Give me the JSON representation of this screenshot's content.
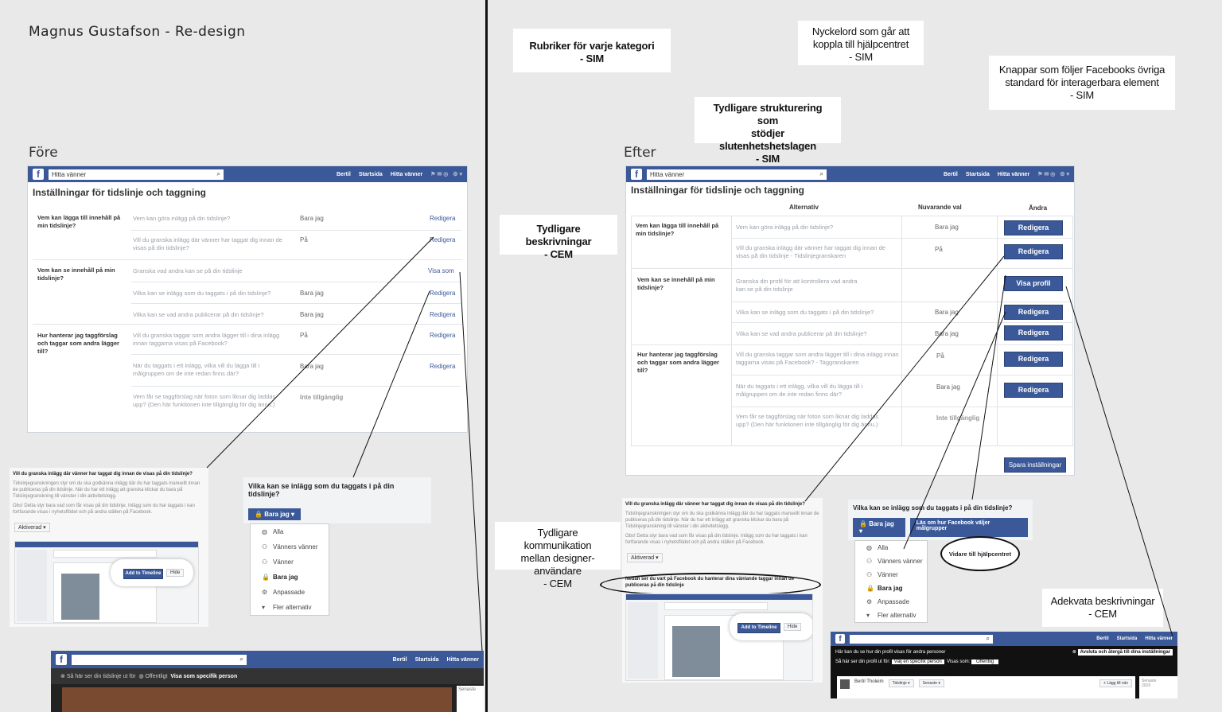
{
  "doc": {
    "title": "Magnus Gustafson - Re-design",
    "before_label": "Före",
    "after_label": "Efter"
  },
  "notes": {
    "rubriker": "Rubriker för varje kategori\n- SIM",
    "nyckelord": "Nyckelord som går att\nkoppla till hjälpcentret\n- SIM",
    "knappar": "Knappar som följer Facebooks övriga\nstandard för interagerbara element\n- SIM",
    "struktur": "Tydligare strukturering som\nstödjer slutenhetshetslagen\n- SIM",
    "beskrivningar": "Tydligare beskrivningar\n- CEM",
    "kommunikation": "Tydligare kommunikation\nmellan designer-användare\n- CEM",
    "adekvata": "Adekvata beskrivningar\n- CEM"
  },
  "fb": {
    "search_placeholder": "Hitta vänner",
    "user": "Bertil",
    "home": "Startsida",
    "find_friends": "Hitta vänner"
  },
  "before": {
    "panel_title": "Inställningar för tidslinje och taggning",
    "sections": [
      {
        "heading": "Vem kan lägga till innehåll på min tidslinje?",
        "rows": [
          {
            "desc": "Vem kan göra inlägg på din tidslinje?",
            "value": "Bara jag",
            "action": "Redigera"
          },
          {
            "desc": "Vill du granska inlägg där vänner har taggat dig innan de visas på din tidslinje?",
            "value": "På",
            "action": "Redigera"
          }
        ]
      },
      {
        "heading": "Vem kan se innehåll på min tidslinje?",
        "rows": [
          {
            "desc": "Granska vad andra kan se på din tidslinje",
            "value": "",
            "action": "Visa som"
          },
          {
            "desc": "Vilka kan se inlägg som du taggats i på din tidslinje?",
            "value": "Bara jag",
            "action": "Redigera"
          },
          {
            "desc": "Vilka kan se vad andra publicerar på din tidslinje?",
            "value": "Bara jag",
            "action": "Redigera"
          }
        ]
      },
      {
        "heading": "Hur hanterar jag taggförslag och taggar som andra lägger till?",
        "rows": [
          {
            "desc": "Vill du granska taggar som andra lägger till i dina inlägg innan taggarna visas på Facebook?",
            "value": "På",
            "action": "Redigera"
          },
          {
            "desc": "När du taggats i ett inlägg, vilka vill du lägga till i målgruppen om de inte redan finns där?",
            "value": "Bara jag",
            "action": "Redigera"
          },
          {
            "desc": "Vem får se taggförslag när foton som liknar dig laddas upp? (Den här funktionen inte tillgänglig för dig ännu.)",
            "value": "Inte tillgänglig",
            "action": ""
          }
        ]
      }
    ],
    "popup_review": {
      "title": "Vill du granska inlägg där vänner har taggat dig innan de visas på din tidslinje?",
      "body": "Tidslinjegranskningen styr om du ska godkänna inlägg där du har taggats manuellt innan de publiceras på din tidslinje. När du har ett inlägg att granska klickar du bara på Tidslinjegranskning till vänster i din aktivitetslogg.",
      "body2": "Obs! Detta styr bara vad som får visas på din tidslinje. Inlägg som du har taggats i kan fortfarande visas i nyhetsflödet och på andra ställen på Facebook.",
      "control": "Aktiverad",
      "add_btn": "Add to Timeline",
      "hide_btn": "Hide"
    },
    "popup_audience": {
      "title": "Vilka kan se inlägg som du taggats i på din tidslinje?",
      "selected": "Bara jag",
      "options": [
        "Alla",
        "Vänners vänner",
        "Vänner",
        "Bara jag",
        "Anpassade",
        "Fler alternativ"
      ]
    },
    "viewas_bar": {
      "text": "Så här ser din tidslinje ut för",
      "public": "Offentligt",
      "specific": "Visa som specifik person",
      "side": "Senaste"
    }
  },
  "after": {
    "panel_title": "Inställningar för tidslinje och taggning",
    "col_alt": "Alternativ",
    "col_cur": "Nuvarande val",
    "col_change": "Ändra",
    "sections": [
      {
        "heading": "Vem kan lägga till innehåll på min tidslinje?",
        "rows": [
          {
            "desc": "Vem kan göra inlägg på din tidslinje?",
            "value": "Bara jag",
            "action": "Redigera"
          },
          {
            "desc": "Vill du granska inlägg där vänner har taggat dig innan de visas på din tidslinje - Tidslinjegranskaren",
            "value": "På",
            "action": "Redigera"
          }
        ]
      },
      {
        "heading": "Vem kan se innehåll på min tidslinje?",
        "rows": [
          {
            "desc": "Granska din profil för att kontrollera vad andra kan se på din tidslinje",
            "value": "",
            "action": "Visa profil"
          },
          {
            "desc": "Vilka kan se inlägg som du taggats i på din tidslinje?",
            "value": "Bara jag",
            "action": "Redigera"
          },
          {
            "desc": "Vilka kan se vad andra publicerar på din tidslinje?",
            "value": "Bara jag",
            "action": "Redigera"
          }
        ]
      },
      {
        "heading": "Hur hanterar jag taggförslag och taggar som andra lägger till?",
        "rows": [
          {
            "desc": "Vill du granska taggar som andra lägger till i dina inlägg innan taggarna visas på Facebook? - Taggranskaren",
            "value": "På",
            "action": "Redigera"
          },
          {
            "desc": "När du taggats i ett inlägg, vilka vill du lägga till i målgruppen om de inte redan finns där?",
            "value": "Bara jag",
            "action": "Redigera"
          },
          {
            "desc": "Vem får se taggförslag när foton som liknar dig laddas upp? (Den här funktionen inte tillgänglig för dig ännu.)",
            "value": "Inte tillgänglig",
            "action": ""
          }
        ]
      }
    ],
    "save_btn": "Spara inställningar",
    "popup_review": {
      "title": "Vill du granska inlägg där vänner har taggat dig innan de visas på din tidslinje?",
      "body": "Tidslinjegranskningen styr om du ska godkänna inlägg där du har taggats manuellt innan de publiceras på din tidslinje. När du har ett inlägg att granska klickar du bara på Tidslinjegranskning till vänster i din aktivitetslogg.",
      "body2": "Obs! Detta styr bara vad som får visas på din tidslinje. Inlägg som du har taggats i kan fortfarande visas i nyhetsflödet och på andra ställen på Facebook.",
      "control": "Aktiverad",
      "highlight": "Nedan ser du vart på Facebook du hanterar dina väntande taggar innan de publiceras på din tidslinje",
      "add_btn": "Add to Timeline",
      "hide_btn": "Hide"
    },
    "popup_audience": {
      "title": "Vilka kan se inlägg som du taggats i på din tidslinje?",
      "selected": "Bara jag",
      "help_btn": "Läs om hur Facebook väljer målgrupper",
      "help_note": "Vidare till hjälpcentret",
      "options": [
        "Alla",
        "Vänners vänner",
        "Vänner",
        "Bara jag",
        "Anpassade",
        "Fler alternativ"
      ]
    },
    "viewas_bar": {
      "line1": "Här kan du se hur din profil visas för andra personer",
      "exit": "Avsluta och återgå till dina inställningar",
      "line2": "Så här ser din profil ut för:",
      "specific": "Välj en specifik person",
      "view_as": "Visas som:",
      "public": "Offentlig",
      "name": "Bertil Tholeim",
      "tab1": "Tidslinje",
      "tab2": "Senaste",
      "add": "Lägg till vän",
      "side": "Senaste",
      "side2": "2015"
    }
  }
}
